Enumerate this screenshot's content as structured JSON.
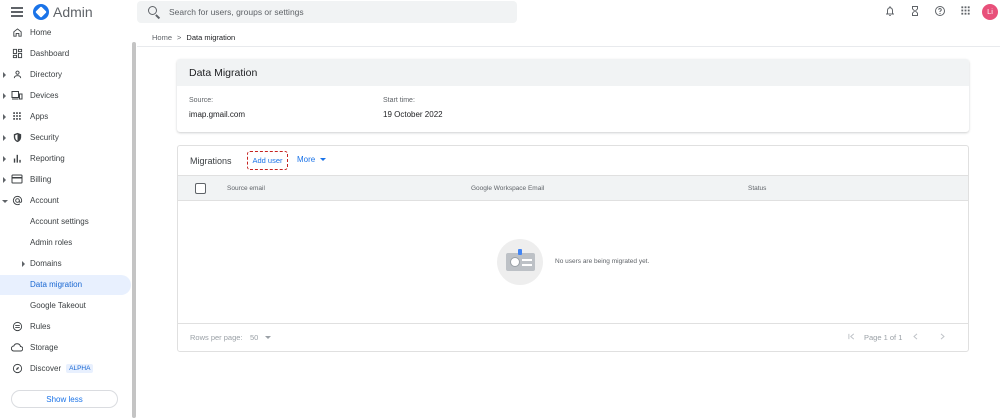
{
  "app": {
    "title": "Admin"
  },
  "search": {
    "placeholder": "Search for users, groups or settings"
  },
  "topbar": {
    "avatar_initials": "Li",
    "icons": [
      "bell-icon",
      "hourglass-icon",
      "help-icon",
      "apps-grid-icon"
    ]
  },
  "sidebar": {
    "items": [
      {
        "label": "Home",
        "icon": "home-icon"
      },
      {
        "label": "Dashboard",
        "icon": "dashboard-icon"
      },
      {
        "label": "Directory",
        "icon": "person-icon"
      },
      {
        "label": "Devices",
        "icon": "devices-icon"
      },
      {
        "label": "Apps",
        "icon": "apps-icon"
      },
      {
        "label": "Security",
        "icon": "shield-icon"
      },
      {
        "label": "Reporting",
        "icon": "bar-chart-icon"
      },
      {
        "label": "Billing",
        "icon": "credit-card-icon"
      },
      {
        "label": "Account",
        "icon": "at-sign-icon"
      },
      {
        "label": "Account settings"
      },
      {
        "label": "Admin roles"
      },
      {
        "label": "Domains"
      },
      {
        "label": "Data migration"
      },
      {
        "label": "Google Takeout"
      },
      {
        "label": "Rules",
        "icon": "rules-icon"
      },
      {
        "label": "Storage",
        "icon": "cloud-icon"
      },
      {
        "label": "Discover",
        "icon": "compass-icon",
        "badge": "ALPHA"
      }
    ],
    "show_less": "Show less"
  },
  "breadcrumb": {
    "home": "Home",
    "sep": ">",
    "current": "Data migration"
  },
  "migration_card": {
    "title": "Data Migration",
    "source_label": "Source:",
    "source_value": "imap.gmail.com",
    "start_label": "Start time:",
    "start_value": "19 October 2022"
  },
  "migrations": {
    "title": "Migrations",
    "add_user": "Add user",
    "more": "More",
    "columns": [
      "Source email",
      "Google Workspace Email",
      "Status"
    ],
    "empty_text": "No users are being migrated yet.",
    "rows_per_page_label": "Rows per page:",
    "rows_per_page_value": "50",
    "page_text": "Page 1 of 1"
  },
  "colors": {
    "accent": "#1a73e8",
    "avatar": "#e8507a",
    "highlight": "#c5221f"
  }
}
